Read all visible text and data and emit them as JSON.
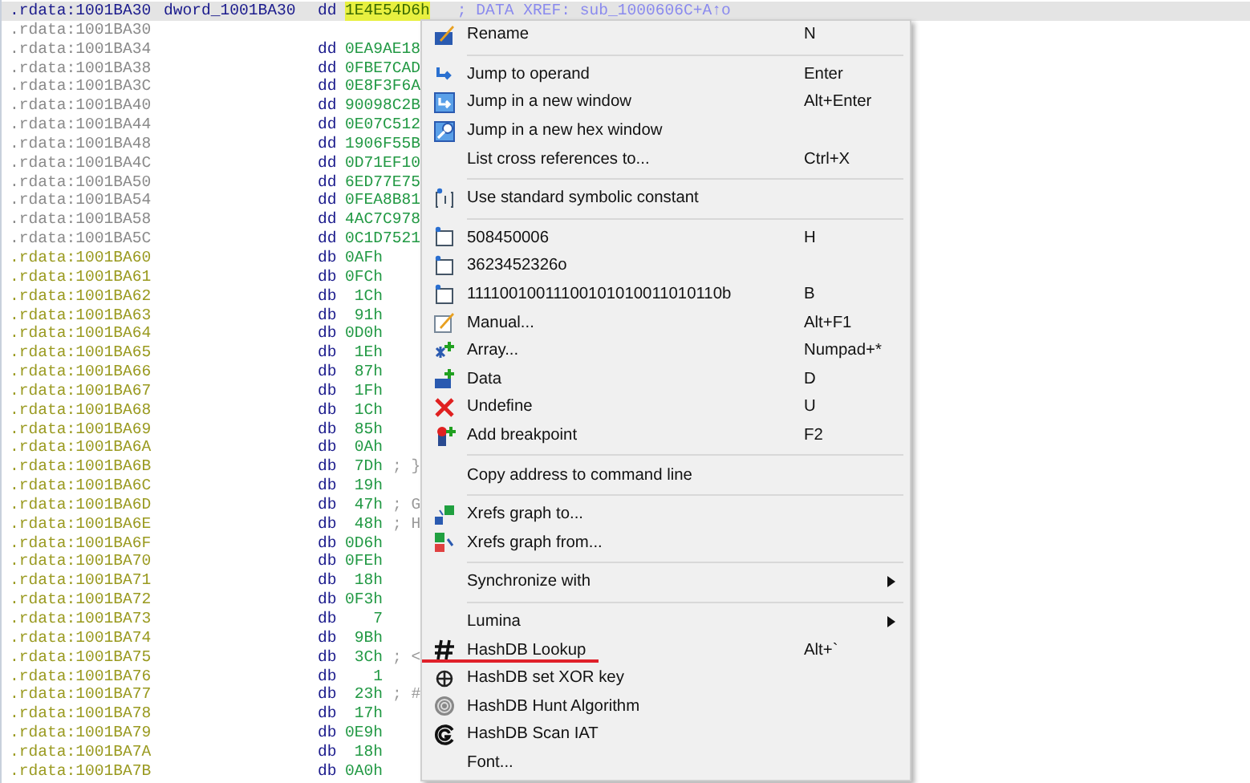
{
  "listing": [
    {
      "kind": "dword",
      "selected": true,
      "address": ".rdata:1001BA30",
      "label": "dword_1001BA30",
      "mnemonic": "dd",
      "operand": "1E4E54D6h",
      "comment": "; DATA XREF: sub_1000606C+A↑o"
    },
    {
      "kind": "blank",
      "selected": false,
      "address": ".rdata:1001BA30"
    },
    {
      "kind": "dword",
      "selected": false,
      "address": ".rdata:1001BA34",
      "mnemonic": "dd",
      "operand": "0EA9AE18"
    },
    {
      "kind": "dword",
      "selected": false,
      "address": ".rdata:1001BA38",
      "mnemonic": "dd",
      "operand": "0FBE7CAD"
    },
    {
      "kind": "dword",
      "selected": false,
      "address": ".rdata:1001BA3C",
      "mnemonic": "dd",
      "operand": "0E8F3F6A"
    },
    {
      "kind": "dword",
      "selected": false,
      "address": ".rdata:1001BA40",
      "mnemonic": "dd",
      "operand": "90098C2B"
    },
    {
      "kind": "dword",
      "selected": false,
      "address": ".rdata:1001BA44",
      "mnemonic": "dd",
      "operand": "0E07C512"
    },
    {
      "kind": "dword",
      "selected": false,
      "address": ".rdata:1001BA48",
      "mnemonic": "dd",
      "operand": "1906F55B"
    },
    {
      "kind": "dword",
      "selected": false,
      "address": ".rdata:1001BA4C",
      "mnemonic": "dd",
      "operand": "0D71EF10"
    },
    {
      "kind": "dword",
      "selected": false,
      "address": ".rdata:1001BA50",
      "mnemonic": "dd",
      "operand": "6ED77E75"
    },
    {
      "kind": "dword",
      "selected": false,
      "address": ".rdata:1001BA54",
      "mnemonic": "dd",
      "operand": "0FEA8B81"
    },
    {
      "kind": "dword",
      "selected": false,
      "address": ".rdata:1001BA58",
      "mnemonic": "dd",
      "operand": "4AC7C978"
    },
    {
      "kind": "dword",
      "selected": false,
      "address": ".rdata:1001BA5C",
      "mnemonic": "dd",
      "operand": "0C1D7521"
    },
    {
      "kind": "byte",
      "selected": false,
      "address": ".rdata:1001BA60",
      "mnemonic": "db",
      "operand": "0AFh"
    },
    {
      "kind": "byte",
      "selected": false,
      "address": ".rdata:1001BA61",
      "mnemonic": "db",
      "operand": "0FCh"
    },
    {
      "kind": "byte",
      "selected": false,
      "address": ".rdata:1001BA62",
      "mnemonic": "db",
      "operand": "1Ch"
    },
    {
      "kind": "byte",
      "selected": false,
      "address": ".rdata:1001BA63",
      "mnemonic": "db",
      "operand": "91h"
    },
    {
      "kind": "byte",
      "selected": false,
      "address": ".rdata:1001BA64",
      "mnemonic": "db",
      "operand": "0D0h"
    },
    {
      "kind": "byte",
      "selected": false,
      "address": ".rdata:1001BA65",
      "mnemonic": "db",
      "operand": "1Eh"
    },
    {
      "kind": "byte",
      "selected": false,
      "address": ".rdata:1001BA66",
      "mnemonic": "db",
      "operand": "87h"
    },
    {
      "kind": "byte",
      "selected": false,
      "address": ".rdata:1001BA67",
      "mnemonic": "db",
      "operand": "1Fh"
    },
    {
      "kind": "byte",
      "selected": false,
      "address": ".rdata:1001BA68",
      "mnemonic": "db",
      "operand": "1Ch"
    },
    {
      "kind": "byte",
      "selected": false,
      "address": ".rdata:1001BA69",
      "mnemonic": "db",
      "operand": "85h"
    },
    {
      "kind": "byte",
      "selected": false,
      "address": ".rdata:1001BA6A",
      "mnemonic": "db",
      "operand": "0Ah"
    },
    {
      "kind": "byte",
      "selected": false,
      "address": ".rdata:1001BA6B",
      "mnemonic": "db",
      "operand": "7Dh",
      "comment": "; }"
    },
    {
      "kind": "byte",
      "selected": false,
      "address": ".rdata:1001BA6C",
      "mnemonic": "db",
      "operand": "19h"
    },
    {
      "kind": "byte",
      "selected": false,
      "address": ".rdata:1001BA6D",
      "mnemonic": "db",
      "operand": "47h",
      "comment": "; G"
    },
    {
      "kind": "byte",
      "selected": false,
      "address": ".rdata:1001BA6E",
      "mnemonic": "db",
      "operand": "48h",
      "comment": "; H"
    },
    {
      "kind": "byte",
      "selected": false,
      "address": ".rdata:1001BA6F",
      "mnemonic": "db",
      "operand": "0D6h"
    },
    {
      "kind": "byte",
      "selected": false,
      "address": ".rdata:1001BA70",
      "mnemonic": "db",
      "operand": "0FEh"
    },
    {
      "kind": "byte",
      "selected": false,
      "address": ".rdata:1001BA71",
      "mnemonic": "db",
      "operand": "18h"
    },
    {
      "kind": "byte",
      "selected": false,
      "address": ".rdata:1001BA72",
      "mnemonic": "db",
      "operand": "0F3h"
    },
    {
      "kind": "byte",
      "selected": false,
      "address": ".rdata:1001BA73",
      "mnemonic": "db",
      "operand": "7"
    },
    {
      "kind": "byte",
      "selected": false,
      "address": ".rdata:1001BA74",
      "mnemonic": "db",
      "operand": "9Bh"
    },
    {
      "kind": "byte",
      "selected": false,
      "address": ".rdata:1001BA75",
      "mnemonic": "db",
      "operand": "3Ch",
      "comment": "; <"
    },
    {
      "kind": "byte",
      "selected": false,
      "address": ".rdata:1001BA76",
      "mnemonic": "db",
      "operand": "1"
    },
    {
      "kind": "byte",
      "selected": false,
      "address": ".rdata:1001BA77",
      "mnemonic": "db",
      "operand": "23h",
      "comment": "; #"
    },
    {
      "kind": "byte",
      "selected": false,
      "address": ".rdata:1001BA78",
      "mnemonic": "db",
      "operand": "17h"
    },
    {
      "kind": "byte",
      "selected": false,
      "address": ".rdata:1001BA79",
      "mnemonic": "db",
      "operand": "0E9h"
    },
    {
      "kind": "byte",
      "selected": false,
      "address": ".rdata:1001BA7A",
      "mnemonic": "db",
      "operand": "18h"
    },
    {
      "kind": "byte",
      "selected": false,
      "address": ".rdata:1001BA7B",
      "mnemonic": "db",
      "operand": "0A0h"
    }
  ],
  "context_menu": [
    {
      "kind": "item",
      "label": "Rename",
      "shortcut": "N",
      "submenu": false,
      "underlined": false
    },
    {
      "kind": "separator"
    },
    {
      "kind": "item",
      "label": "Jump to operand",
      "shortcut": "Enter",
      "submenu": false,
      "underlined": false
    },
    {
      "kind": "item",
      "label": "Jump in a new window",
      "shortcut": "Alt+Enter",
      "submenu": false,
      "underlined": false
    },
    {
      "kind": "item",
      "label": "Jump in a new hex window",
      "submenu": false,
      "underlined": false
    },
    {
      "kind": "item",
      "label": "List cross references to...",
      "shortcut": "Ctrl+X",
      "submenu": false,
      "underlined": false
    },
    {
      "kind": "separator"
    },
    {
      "kind": "item",
      "label": "Use standard symbolic constant",
      "submenu": false,
      "underlined": false
    },
    {
      "kind": "separator"
    },
    {
      "kind": "item",
      "label": "508450006",
      "shortcut": "H",
      "submenu": false,
      "underlined": false
    },
    {
      "kind": "item",
      "label": "3623452326o",
      "submenu": false,
      "underlined": false
    },
    {
      "kind": "item",
      "label": "11110010011100101010011010110b",
      "shortcut": "B",
      "submenu": false,
      "underlined": false
    },
    {
      "kind": "item",
      "label": "Manual...",
      "shortcut": "Alt+F1",
      "submenu": false,
      "underlined": false
    },
    {
      "kind": "item",
      "label": "Array...",
      "shortcut": "Numpad+*",
      "submenu": false,
      "underlined": false
    },
    {
      "kind": "item",
      "label": "Data",
      "shortcut": "D",
      "submenu": false,
      "underlined": false
    },
    {
      "kind": "item",
      "label": "Undefine",
      "shortcut": "U",
      "submenu": false,
      "underlined": false
    },
    {
      "kind": "item",
      "label": "Add breakpoint",
      "shortcut": "F2",
      "submenu": false,
      "underlined": false
    },
    {
      "kind": "separator"
    },
    {
      "kind": "item",
      "label": "Copy address to command line",
      "submenu": false,
      "underlined": false
    },
    {
      "kind": "separator"
    },
    {
      "kind": "item",
      "label": "Xrefs graph to...",
      "submenu": false,
      "underlined": false
    },
    {
      "kind": "item",
      "label": "Xrefs graph from...",
      "submenu": false,
      "underlined": false
    },
    {
      "kind": "separator"
    },
    {
      "kind": "item",
      "label": "Synchronize with",
      "submenu": true,
      "underlined": false
    },
    {
      "kind": "separator"
    },
    {
      "kind": "item",
      "label": "Lumina",
      "submenu": true,
      "underlined": false
    },
    {
      "kind": "item",
      "label": "HashDB Lookup",
      "shortcut": "Alt+`",
      "submenu": false,
      "underlined": true
    },
    {
      "kind": "item",
      "label": "HashDB set XOR key",
      "submenu": false,
      "underlined": false
    },
    {
      "kind": "item",
      "label": "HashDB Hunt Algorithm",
      "submenu": false,
      "underlined": false
    },
    {
      "kind": "item",
      "label": "HashDB Scan IAT",
      "submenu": false,
      "underlined": false
    },
    {
      "kind": "item",
      "label": "Font...",
      "submenu": false,
      "underlined": false
    }
  ]
}
